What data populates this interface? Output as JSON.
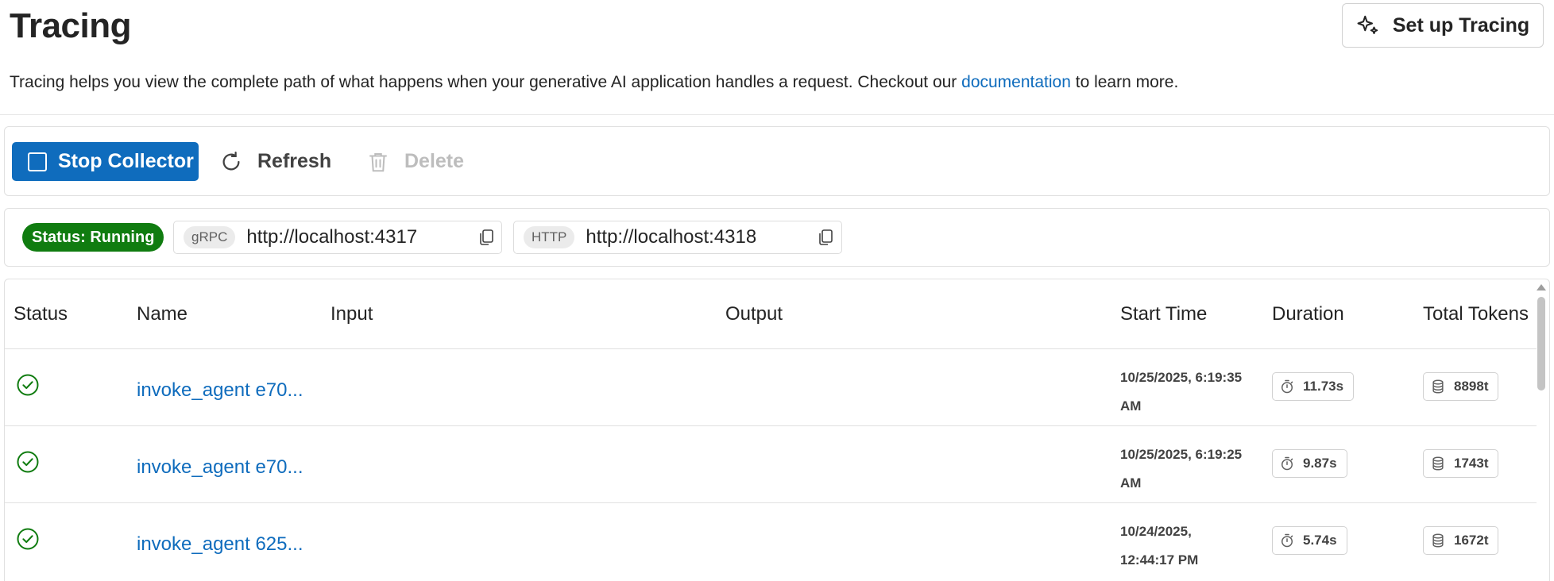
{
  "header": {
    "title": "Tracing",
    "setup_button": "Set up Tracing",
    "description_prefix": "Tracing helps you view the complete path of what happens when your generative AI application handles a request. Checkout our ",
    "description_link": "documentation",
    "description_suffix": " to learn more."
  },
  "toolbar": {
    "stop_label": "Stop Collector",
    "refresh_label": "Refresh",
    "delete_label": "Delete"
  },
  "status": {
    "badge": "Status: Running",
    "grpc": {
      "protocol": "gRPC",
      "url": "http://localhost:4317"
    },
    "http": {
      "protocol": "HTTP",
      "url": "http://localhost:4318"
    }
  },
  "table": {
    "columns": [
      "Status",
      "Name",
      "Input",
      "Output",
      "Start Time",
      "Duration",
      "Total Tokens"
    ],
    "rows": [
      {
        "name": "invoke_agent e70...",
        "start_time": "10/25/2025, 6:19:35 AM",
        "duration": "11.73s",
        "tokens": "8898t"
      },
      {
        "name": "invoke_agent e70...",
        "start_time": "10/25/2025, 6:19:25 AM",
        "duration": "9.87s",
        "tokens": "1743t"
      },
      {
        "name": "invoke_agent 625...",
        "start_time": "10/24/2025, 12:44:17 PM",
        "duration": "5.74s",
        "tokens": "1672t"
      }
    ]
  },
  "colors": {
    "accent": "#0f6cbd",
    "status_success": "#107c10"
  },
  "icons": {
    "setup": "sparkle-icon",
    "refresh": "refresh-icon",
    "delete": "trash-icon",
    "copy": "copy-icon",
    "row_status": "check-circle-icon",
    "duration": "timer-icon",
    "tokens": "database-icon"
  }
}
